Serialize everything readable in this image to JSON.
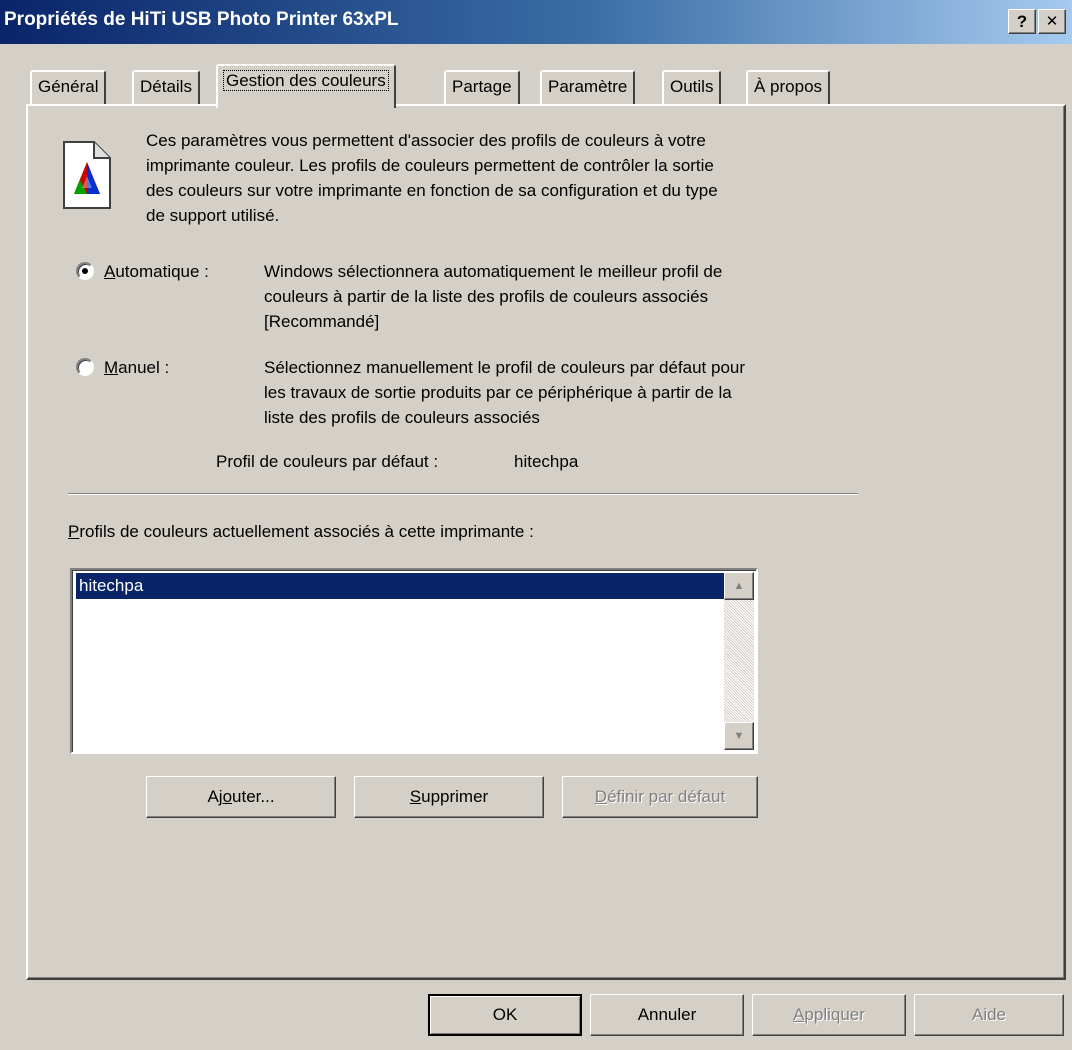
{
  "window": {
    "title": "Propriétés de HiTi USB Photo Printer 63xPL",
    "help_btn": "?",
    "close_btn": "✕"
  },
  "tabs": [
    {
      "label": "Général"
    },
    {
      "label": "Détails"
    },
    {
      "label": "Gestion des couleurs",
      "active": true
    },
    {
      "label": "Partage"
    },
    {
      "label": "Paramètre"
    },
    {
      "label": "Outils"
    },
    {
      "label": "À propos"
    }
  ],
  "intro": {
    "lines": [
      "Ces paramètres vous permettent d'associer des profils de couleurs à votre",
      "imprimante couleur. Les profils de couleurs permettent de contrôler la sortie",
      "des couleurs sur votre imprimante en fonction de sa configuration et du type",
      "de support utilisé."
    ]
  },
  "radio_auto": {
    "accel": "A",
    "rest": "utomatique :",
    "selected": true,
    "desc_lines": [
      "Windows sélectionnera automatiquement le meilleur profil de",
      "couleurs à partir de la liste des profils de couleurs associés",
      "[Recommandé]"
    ]
  },
  "radio_manual": {
    "accel": "M",
    "rest": "anuel :",
    "selected": false,
    "desc_lines": [
      "Sélectionnez manuellement le profil de couleurs par défaut pour",
      "les travaux de sortie produits par ce périphérique à partir de la",
      "liste des profils de couleurs associés"
    ]
  },
  "default_profile": {
    "label": "Profil de couleurs par défaut :",
    "value": "hitechpa"
  },
  "profiles_list": {
    "label_accel": "P",
    "label_rest": "rofils de couleurs actuellement associés à cette imprimante :",
    "items": [
      "hitechpa"
    ],
    "selected_index": 0
  },
  "list_buttons": {
    "add": {
      "pre": "Aj",
      "accel": "o",
      "post": "uter..."
    },
    "remove": {
      "pre": "",
      "accel": "S",
      "post": "upprimer"
    },
    "set_default": {
      "pre": "",
      "accel": "D",
      "post": "éfinir par défaut",
      "disabled": true
    }
  },
  "dialog_buttons": {
    "ok": "OK",
    "cancel": "Annuler",
    "apply": {
      "accel": "A",
      "post": "ppliquer",
      "disabled": true
    },
    "help": {
      "label": "Aide",
      "disabled": true
    }
  },
  "colors": {
    "titlebar_start": "#0a246a",
    "titlebar_end": "#a6caf0",
    "face": "#d4d0c8",
    "selection": "#0a246a"
  }
}
